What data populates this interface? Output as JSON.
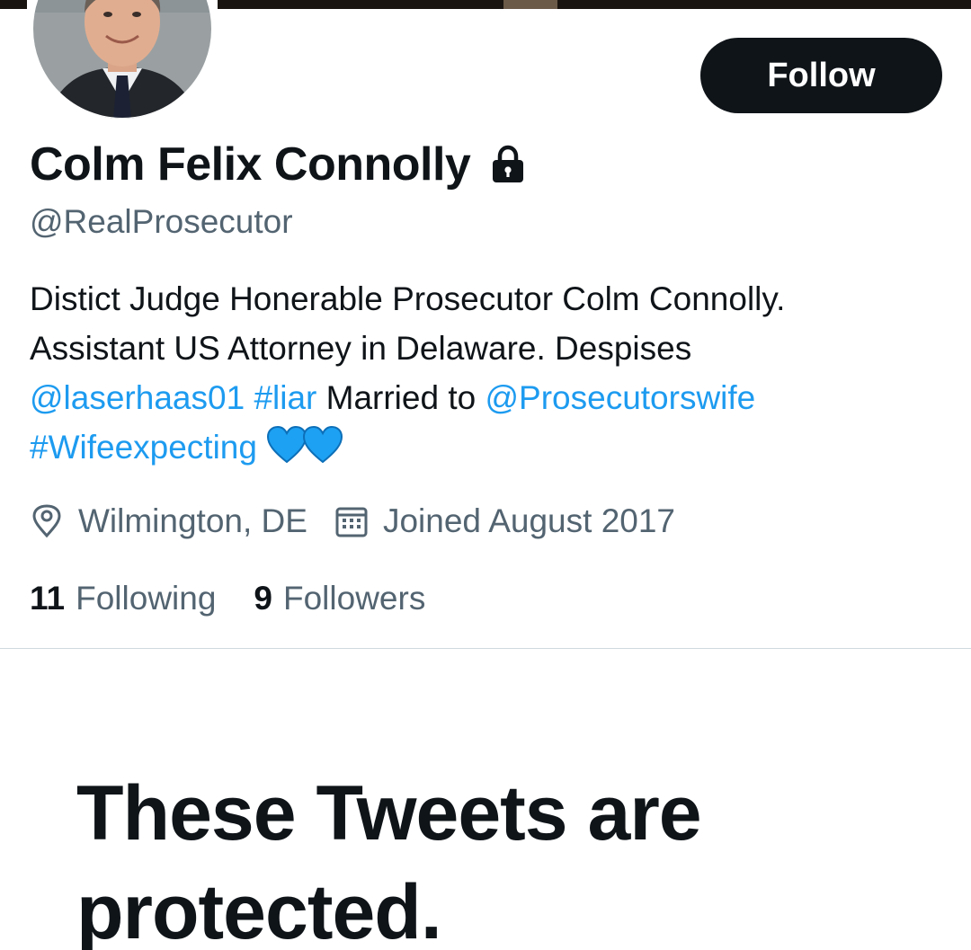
{
  "profile": {
    "display_name": "Colm Felix Connolly",
    "handle": "@RealProsecutor",
    "follow_label": "Follow",
    "bio": {
      "line1": "Distict Judge Honerable Prosecutor Colm Connolly.",
      "line2": "Assistant US Attorney in Delaware. Despises",
      "mention1": "@laserhaas01",
      "hashtag1": "#liar",
      "text_married": "Married to",
      "mention2": "@Prosecutorswife",
      "hashtag2": "#Wifeexpecting",
      "emoji": "💙💙"
    },
    "location": "Wilmington, DE",
    "joined": "Joined August 2017",
    "following_count": "11",
    "following_label": "Following",
    "followers_count": "9",
    "followers_label": "Followers"
  },
  "protected_notice": {
    "heading": "These Tweets are protected."
  },
  "icons": {
    "lock": "lock-icon",
    "location": "location-pin-icon",
    "calendar": "calendar-icon",
    "heart": "blue-heart-icon"
  },
  "colors": {
    "text_primary": "#0f1419",
    "text_secondary": "#536471",
    "link": "#1d9bf0",
    "follow_button_bg": "#0f1419",
    "follow_button_text": "#ffffff",
    "heart": "#1da1f2",
    "divider": "#cfd9de"
  }
}
